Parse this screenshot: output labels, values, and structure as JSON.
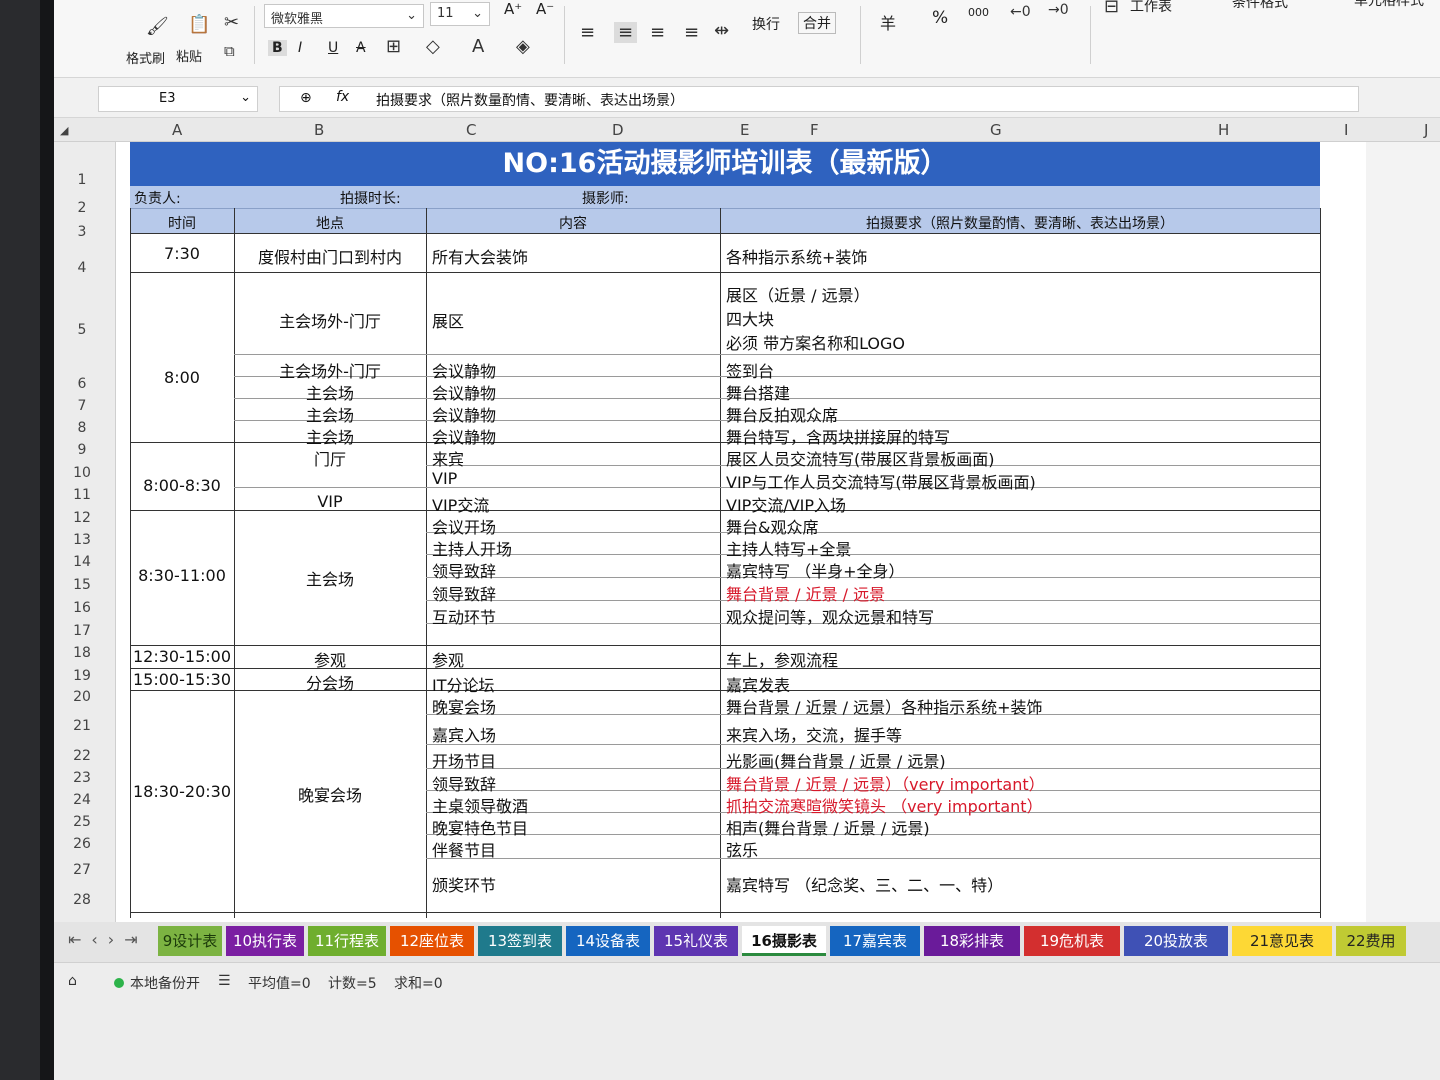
{
  "ribbon": {
    "format_painter": "格式刷",
    "paste": "粘贴",
    "font_name": "微软雅黑",
    "font_size": "11",
    "wrap": "换行",
    "merge": "合并",
    "currency": "羊",
    "percent": "%",
    "thousands": "000",
    "worksheet": "工作表",
    "conditional_format": "条件格式",
    "cell_style": "单元格样式",
    "bold": "B",
    "italic": "I",
    "underline": "U",
    "strike": "A"
  },
  "formula_bar": {
    "name_box": "E3",
    "fx": "fx",
    "content": "拍摄要求（照片数量酌情、要清晰、表达出场景）"
  },
  "columns": [
    "A",
    "B",
    "C",
    "D",
    "E",
    "F",
    "G",
    "H",
    "I",
    "J"
  ],
  "rows": [
    "1",
    "2",
    "3",
    "4",
    "5",
    "6",
    "7",
    "8",
    "9",
    "10",
    "11",
    "12",
    "13",
    "14",
    "15",
    "16",
    "17",
    "18",
    "19",
    "20",
    "21",
    "22",
    "23",
    "24",
    "25",
    "26",
    "27",
    "28"
  ],
  "sheet": {
    "title": "NO:16活动摄影师培训表（最新版）",
    "label_owner": "负责人:",
    "label_duration": "拍摄时长:",
    "label_photographer": "摄影师:",
    "header": {
      "time": "时间",
      "place": "地点",
      "content": "内容",
      "requirement": "拍摄要求（照片数量酌情、要清晰、表达出场景）"
    },
    "times": {
      "t1": "7:30",
      "t2": "8:00",
      "t3": "8:00-8:30",
      "t4": "8:30-11:00",
      "t5": "12:30-15:00",
      "t6": "15:00-15:30",
      "t7": "18:30-20:30"
    },
    "places": {
      "p1": "度假村由门口到村内",
      "p2": "主会场外-门厅",
      "p3": "主会场外-门厅",
      "p4": "主会场",
      "p5": "主会场",
      "p6": "主会场",
      "p7": "门厅",
      "p8": "VIP",
      "p9": "主会场",
      "p10": "参观",
      "p11": "分会场",
      "p12": "晚宴会场"
    },
    "contents": {
      "c1": "所有大会装饰",
      "c2": "展区",
      "c3": "会议静物",
      "c4": "会议静物",
      "c5": "会议静物",
      "c6": "会议静物",
      "c7": "来宾",
      "c8": "VIP",
      "c9": "VIP交流",
      "c10": "会议开场",
      "c11": "主持人开场",
      "c12": "领导致辞",
      "c13": "领导致辞",
      "c14": "互动环节",
      "c15": "参观",
      "c16": "IT分论坛",
      "c17": "晚宴会场",
      "c18": "嘉宾入场",
      "c19": "开场节目",
      "c20": "领导致辞",
      "c21": "主桌领导敬酒",
      "c22": "晚宴特色节目",
      "c23": "伴餐节目",
      "c24": "颁奖环节"
    },
    "requirements": {
      "r1": "各种指示系统+装饰",
      "r2a": "展区（近景 / 远景）",
      "r2b": "四大块",
      "r2c": "必须 带方案名称和LOGO",
      "r3": "签到台",
      "r4": "舞台搭建",
      "r5": "舞台反拍观众席",
      "r6": "舞台特写，含两块拼接屏的特写",
      "r7": "展区人员交流特写(带展区背景板画面)",
      "r8": "VIP与工作人员交流特写(带展区背景板画面)",
      "r9": "VIP交流/VIP入场",
      "r10": "舞台&观众席",
      "r11": "主持人特写+全景",
      "r12": "嘉宾特写 （半身+全身）",
      "r13": "舞台背景 / 近景 / 远景",
      "r14": "观众提问等，观众远景和特写",
      "r15": "车上，参观流程",
      "r16": "嘉宾发表",
      "r17": "舞台背景 / 近景 / 远景）各种指示系统+装饰",
      "r18": "来宾入场，交流，握手等",
      "r19": "光影画(舞台背景 / 近景 / 远景)",
      "r20": "舞台背景 / 近景 / 远景）（very important）",
      "r21": "抓拍交流寒暄微笑镜头 （very important）",
      "r22": "相声(舞台背景 / 近景 / 远景)",
      "r23": "弦乐",
      "r24": "嘉宾特写 （纪念奖、三、二、一、特）"
    }
  },
  "tabs": [
    {
      "label": "9设计表",
      "color": "#7cb342",
      "text": "#1b3a0a"
    },
    {
      "label": "10执行表",
      "color": "#7b1fa2",
      "text": "#ffffff"
    },
    {
      "label": "11行程表",
      "color": "#6fae2e",
      "text": "#ffffff"
    },
    {
      "label": "12座位表",
      "color": "#e65100",
      "text": "#ffffff"
    },
    {
      "label": "13签到表",
      "color": "#1f7a8c",
      "text": "#ffffff"
    },
    {
      "label": "14设备表",
      "color": "#1565c0",
      "text": "#ffffff"
    },
    {
      "label": "15礼仪表",
      "color": "#5e35b1",
      "text": "#ffffff"
    },
    {
      "label": "16摄影表",
      "color": "#ffffff",
      "text": "#111111"
    },
    {
      "label": "17嘉宾表",
      "color": "#1565c0",
      "text": "#ffffff"
    },
    {
      "label": "18彩排表",
      "color": "#6a1b9a",
      "text": "#ffffff"
    },
    {
      "label": "19危机表",
      "color": "#d32f2f",
      "text": "#ffffff"
    },
    {
      "label": "20投放表",
      "color": "#3f51b5",
      "text": "#ffffff"
    },
    {
      "label": "21意见表",
      "color": "#fdd835",
      "text": "#222222"
    },
    {
      "label": "22费用",
      "color": "#c0ca33",
      "text": "#222222"
    }
  ],
  "status": {
    "backup": "本地备份开",
    "average": "平均值=0",
    "count": "计数=5",
    "sum": "求和=0"
  },
  "colors": {
    "title_bg": "#2f62bf",
    "header_bg": "#b7c9ea",
    "important_text": "#d7182a"
  }
}
